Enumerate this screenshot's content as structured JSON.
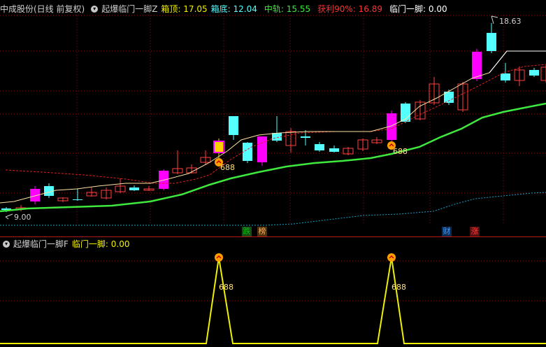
{
  "header": {
    "stock": "中成股份(日线 前复权)",
    "indicator": "起爆临门一脚Z",
    "box_top_label": "箱顶:",
    "box_top_value": "17.05",
    "box_bottom_label": "箱底:",
    "box_bottom_value": "12.04",
    "mid_label": "中轨:",
    "mid_value": "15.55",
    "profit_label": "获利90%:",
    "profit_value": "16.89",
    "kick_label": "临门一脚:",
    "kick_value": "0.00"
  },
  "sub_header": {
    "indicator": "起爆临门一脚F",
    "kick_label": "临门一脚:",
    "kick_value": "0.00"
  },
  "annotations": {
    "high_price": "18.63",
    "low_price": "9.00",
    "signal_text_1": "688",
    "signal_text_2": "688",
    "sub_signal_1": "688",
    "sub_signal_2": "688"
  },
  "tags": [
    {
      "text": "跌",
      "color": "#00c000",
      "bg": "#1a4a1a"
    },
    {
      "text": "榜",
      "color": "#ffb050",
      "bg": "#4a3010"
    },
    {
      "text": "财",
      "color": "#40a0ff",
      "bg": "#102a50"
    },
    {
      "text": "涨",
      "color": "#ff4040",
      "bg": "#501010"
    }
  ],
  "colors": {
    "up": "#ff4040",
    "down": "#54ffff",
    "magenta": "#ff00ff",
    "green_line": "#3ee83e",
    "white_line": "#ffffff",
    "red_dash": "#e02020",
    "cyan_dash": "#1aa0c8",
    "yellow": "#f0f000"
  }
}
